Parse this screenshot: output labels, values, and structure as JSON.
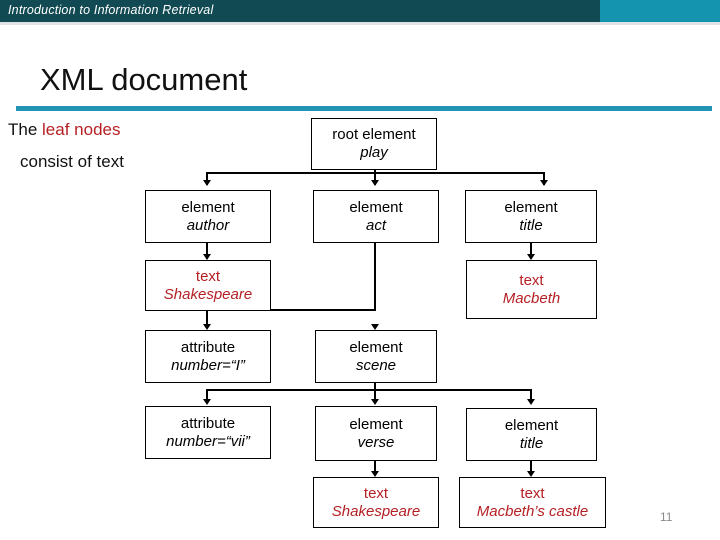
{
  "header": {
    "title": "Introduction to Information Retrieval",
    "bar_dark_color": "#114a52",
    "bar_light_color": "#1594b0"
  },
  "slide": {
    "title": "XML document",
    "rule_color": "#2494b4",
    "page_number": "11"
  },
  "caption": {
    "line1_prefix": "The ",
    "line1_highlight": "leaf nodes",
    "line2": "consist of text",
    "highlight_color": "#b52025"
  },
  "tree": {
    "nodes": [
      {
        "id": "root",
        "type": "root element",
        "value": "play",
        "kind": "element"
      },
      {
        "id": "author",
        "type": "element",
        "value": "author",
        "kind": "element"
      },
      {
        "id": "act",
        "type": "element",
        "value": "act",
        "kind": "element"
      },
      {
        "id": "title",
        "type": "element",
        "value": "title",
        "kind": "element"
      },
      {
        "id": "text-shakespeare",
        "type": "text",
        "value": "Shakespeare",
        "kind": "text"
      },
      {
        "id": "text-macbeth",
        "type": "text",
        "value": "Macbeth",
        "kind": "text"
      },
      {
        "id": "attr-number-i",
        "type": "attribute",
        "value": "number=“I”",
        "kind": "attribute"
      },
      {
        "id": "scene",
        "type": "element",
        "value": "scene",
        "kind": "element"
      },
      {
        "id": "attr-number-vii",
        "type": "attribute",
        "value": "number=“vii”",
        "kind": "attribute"
      },
      {
        "id": "verse",
        "type": "element",
        "value": "verse",
        "kind": "element"
      },
      {
        "id": "title2",
        "type": "element",
        "value": "title",
        "kind": "element"
      },
      {
        "id": "text-shakespeare2",
        "type": "text",
        "value": "Shakespeare",
        "kind": "text"
      },
      {
        "id": "text-macbeths-castle",
        "type": "text",
        "value": "Macbeth’s castle",
        "kind": "text"
      }
    ]
  }
}
